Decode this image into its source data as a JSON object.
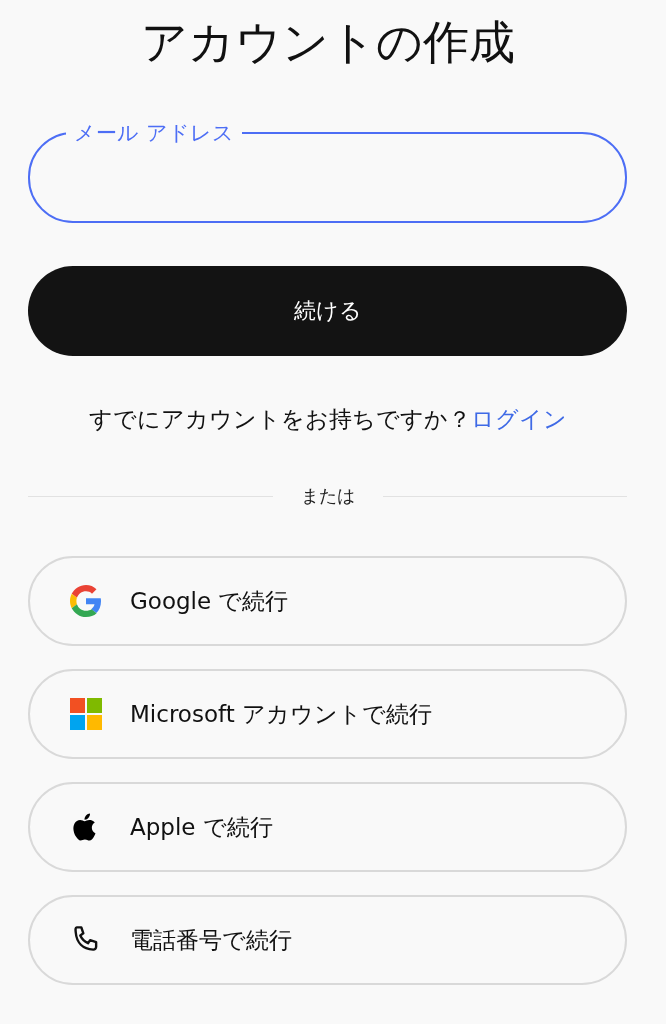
{
  "title": "アカウントの作成",
  "email_field": {
    "label": "メール アドレス",
    "focused": true
  },
  "continue_button": "続ける",
  "login_prompt": {
    "text": "すでにアカウントをお持ちですか？",
    "link": "ログイン"
  },
  "divider": "または",
  "providers": [
    {
      "kind": "google",
      "label": "Google で続行"
    },
    {
      "kind": "microsoft",
      "label": "Microsoft アカウントで続行"
    },
    {
      "kind": "apple",
      "label": "Apple で続行"
    },
    {
      "kind": "phone",
      "label": "電話番号で続行"
    }
  ]
}
